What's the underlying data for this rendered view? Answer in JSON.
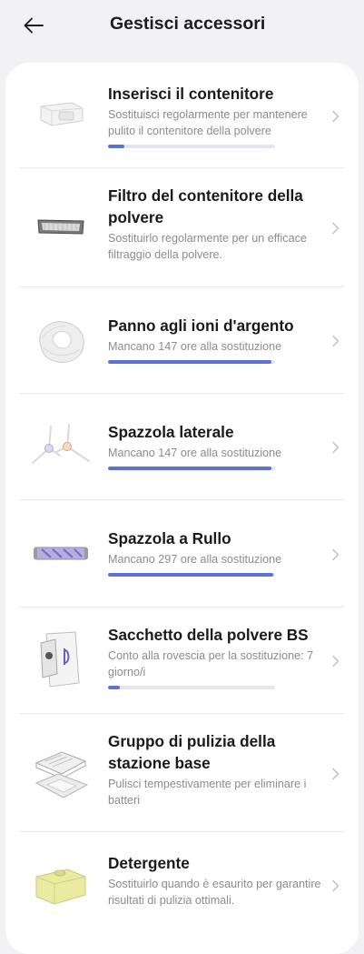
{
  "header": {
    "title": "Gestisci accessori",
    "back_icon": "arrow-left-icon"
  },
  "colors": {
    "accent": "#5b72d6",
    "track": "#e3e6f2",
    "background": "#f2f2f4",
    "card": "#ffffff",
    "subtitle": "#8c8c91"
  },
  "accessories": [
    {
      "title": "Inserisci il contenitore",
      "subtitle": "Sostituisci regolarmente per mantenere pulito il contenitore della polvere",
      "progress": 0.1,
      "icon": "dust-container-icon"
    },
    {
      "title": "Filtro del contenitore della polvere",
      "subtitle": "Sostituirlo regolarmente per un efficace filtraggio della polvere.",
      "icon": "filter-icon"
    },
    {
      "title": "Panno agli ioni d'argento",
      "subtitle": "Mancano 147 ore alla sostituzione",
      "progress": 0.98,
      "icon": "mop-cloth-icon"
    },
    {
      "title": "Spazzola laterale",
      "subtitle": "Mancano 147 ore alla sostituzione",
      "progress": 0.98,
      "icon": "side-brush-icon"
    },
    {
      "title": "Spazzola a Rullo",
      "subtitle": "Mancano 297 ore alla sostituzione",
      "progress": 0.99,
      "icon": "roller-brush-icon"
    },
    {
      "title": "Sacchetto della polvere BS",
      "subtitle": "Conto alla rovescia per la sostituzione: 7 giorno/i",
      "progress": 0.07,
      "icon": "dust-bag-icon"
    },
    {
      "title": "Gruppo di pulizia della stazione base",
      "subtitle": "Pulisci tempestivamente per eliminare i batteri",
      "icon": "base-station-tray-icon"
    },
    {
      "title": "Detergente",
      "subtitle": "Sostituirlo quando è esaurito per garantire risultati di pulizia ottimali.",
      "icon": "detergent-icon"
    }
  ]
}
